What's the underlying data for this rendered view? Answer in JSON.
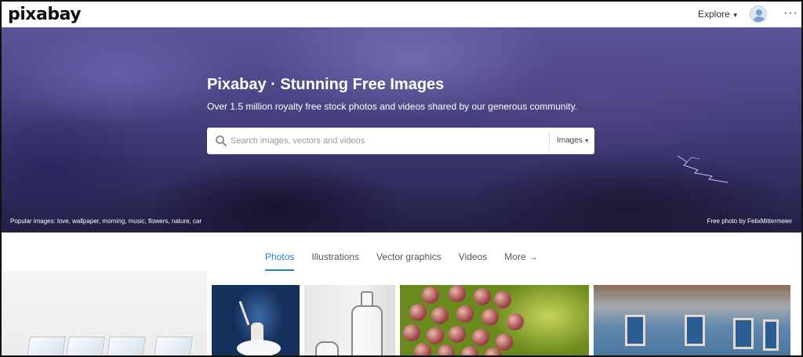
{
  "brand": {
    "logo_text": "pixabay"
  },
  "nav": {
    "explore_label": "Explore",
    "more_label": "···"
  },
  "hero": {
    "title": "Pixabay · Stunning Free Images",
    "subtitle": "Over 1.5 million royalty free stock photos and videos shared by our generous community.",
    "search": {
      "placeholder": "Search images, vectors and videos",
      "value": "",
      "type_selected": "Images"
    },
    "popular_text": "Popular images: love, wallpaper, morning, music, flowers, nature, car",
    "credit_text": "Free photo by FelixMittermeier"
  },
  "tabs": [
    {
      "label": "Photos",
      "active": true
    },
    {
      "label": "Illustrations",
      "active": false
    },
    {
      "label": "Vector graphics",
      "active": false
    },
    {
      "label": "Videos",
      "active": false
    },
    {
      "label": "More →",
      "active": false
    }
  ],
  "colors": {
    "accent": "#2a7fbf",
    "hero_sky": "#4a4585"
  },
  "icons": [
    "search-icon",
    "user-avatar-icon",
    "more-dots-icon",
    "chevron-down-icon"
  ]
}
